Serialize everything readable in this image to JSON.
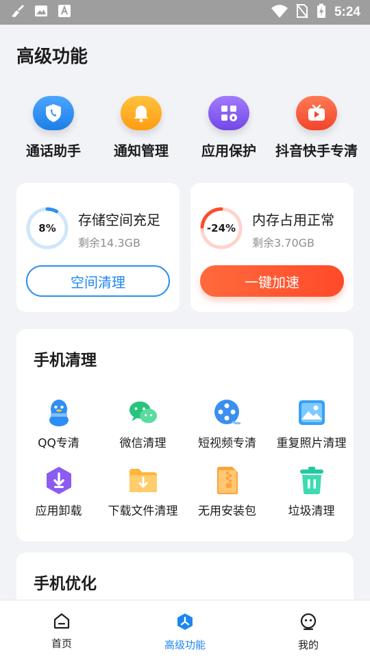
{
  "status_bar": {
    "time": "5:24"
  },
  "page": {
    "title": "高级功能"
  },
  "quick_actions": [
    {
      "label": "通话助手",
      "icon": "phone-shield-icon",
      "color": "#2f8ff2"
    },
    {
      "label": "通知管理",
      "icon": "bell-icon",
      "color": "#ffad1f"
    },
    {
      "label": "应用保护",
      "icon": "app-lock-icon",
      "color": "#8a5cf0"
    },
    {
      "label": "抖音快手专清",
      "icon": "tv-play-icon",
      "color": "#ff5a3c"
    }
  ],
  "storage": {
    "percent_label": "8%",
    "percent": 8,
    "title": "存储空间充足",
    "subtitle": "剩余14.3GB",
    "button": "空间清理"
  },
  "memory": {
    "percent_label": "-24%",
    "percent": 24,
    "title": "内存占用正常",
    "subtitle": "剩余3.70GB",
    "button": "一键加速"
  },
  "phone_clean": {
    "title": "手机清理",
    "items": [
      {
        "label": "QQ专清",
        "icon": "qq-penguin-icon"
      },
      {
        "label": "微信清理",
        "icon": "wechat-icon"
      },
      {
        "label": "短视频专清",
        "icon": "film-reel-icon"
      },
      {
        "label": "重复照片清理",
        "icon": "photo-icon"
      },
      {
        "label": "应用卸载",
        "icon": "uninstall-icon"
      },
      {
        "label": "下载文件清理",
        "icon": "download-folder-icon"
      },
      {
        "label": "无用安装包",
        "icon": "zip-package-icon"
      },
      {
        "label": "垃圾清理",
        "icon": "trash-icon"
      }
    ]
  },
  "phone_optimize": {
    "title": "手机优化"
  },
  "tabbar": [
    {
      "label": "首页",
      "icon": "home-icon",
      "active": false
    },
    {
      "label": "高级功能",
      "icon": "advanced-icon",
      "active": true
    },
    {
      "label": "我的",
      "icon": "profile-icon",
      "active": false
    }
  ],
  "colors": {
    "accent": "#1e86f0",
    "danger": "#ff4a2a"
  }
}
